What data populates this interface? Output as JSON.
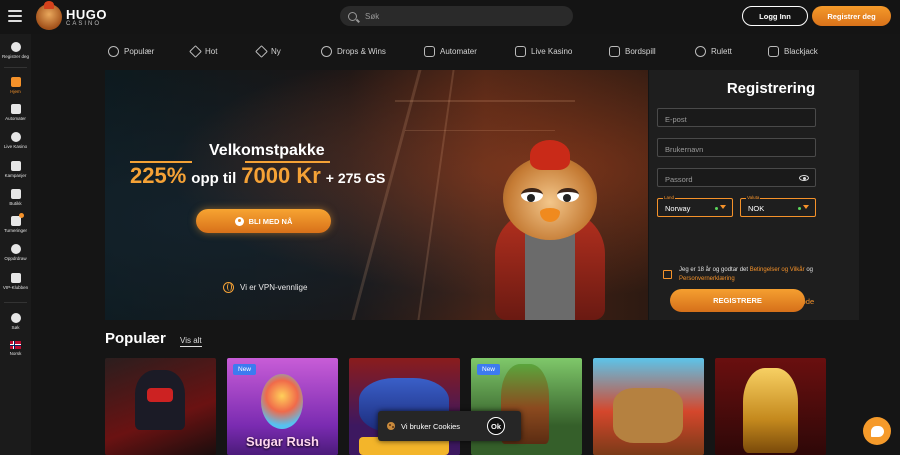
{
  "header": {
    "logo_main": "HUGO",
    "logo_sub": "CASINO",
    "search_placeholder": "Søk",
    "login_label": "Logg Inn",
    "register_label": "Registrer deg"
  },
  "sidebar": {
    "items": [
      {
        "label": "Registrer deg",
        "icon": "user-circle-icon"
      },
      {
        "label": "Hjem",
        "icon": "home-icon"
      },
      {
        "label": "Automater",
        "icon": "slot-machine-icon"
      },
      {
        "label": "Live Kasino",
        "icon": "spade-icon"
      },
      {
        "label": "Kampanjer",
        "icon": "gift-icon"
      },
      {
        "label": "Butikk",
        "icon": "shop-icon"
      },
      {
        "label": "Turneringer",
        "icon": "trophy-icon"
      },
      {
        "label": "Oppdrdraw",
        "icon": "medal-icon"
      },
      {
        "label": "VIP-Klubben",
        "icon": "crown-icon"
      },
      {
        "label": "Søk",
        "icon": "search-icon"
      },
      {
        "label": "Norsk",
        "icon": "norway-flag-icon"
      }
    ]
  },
  "categories": [
    {
      "label": "Populær",
      "icon": "fire-icon"
    },
    {
      "label": "Hot",
      "icon": "flame-icon"
    },
    {
      "label": "Ny",
      "icon": "new-icon"
    },
    {
      "label": "Drops & Wins",
      "icon": "drops-icon"
    },
    {
      "label": "Automater",
      "icon": "slot-machine-icon"
    },
    {
      "label": "Live Kasino",
      "icon": "spade-icon"
    },
    {
      "label": "Bordspill",
      "icon": "cards-icon"
    },
    {
      "label": "Rulett",
      "icon": "roulette-icon"
    },
    {
      "label": "Blackjack",
      "icon": "blackjack-icon"
    }
  ],
  "hero": {
    "title": "Velkomstpakke",
    "offer_percent": "225%",
    "offer_mid": "opp til",
    "offer_amount": "7000 Kr",
    "offer_extra": "+ 275 GS",
    "join_label": "BLI MED NÅ",
    "vpn_label": "Vi er VPN-vennlige"
  },
  "registration": {
    "title": "Registrering",
    "email_placeholder": "E-post",
    "username_placeholder": "Brukernavn",
    "password_placeholder": "Passord",
    "country_caption": "Land",
    "country_value": "Norway",
    "currency_caption": "Valuta",
    "currency_value": "NOK",
    "terms_prefix": "Jeg er 18 år og godtar det",
    "terms_link1": "Betingelser og Vilkår",
    "terms_mid": "og",
    "terms_link2": "Personvernerklæring",
    "promo_link": "Jeg har en kampanjekode",
    "submit_label": "REGISTRERE"
  },
  "popular": {
    "title": "Populær",
    "see_all": "Vis alt",
    "games": [
      {
        "name": "",
        "badge": ""
      },
      {
        "name": "Sugar Rush",
        "badge": "New"
      },
      {
        "name": "",
        "badge": ""
      },
      {
        "name": "",
        "badge": "New"
      },
      {
        "name": "",
        "badge": ""
      },
      {
        "name": "",
        "badge": ""
      }
    ]
  },
  "cookie": {
    "text": "Vi bruker Cookies",
    "ok_label": "Ok"
  },
  "colors": {
    "accent": "#f5922a",
    "background": "#141414",
    "new_badge": "#3d7bf0"
  }
}
